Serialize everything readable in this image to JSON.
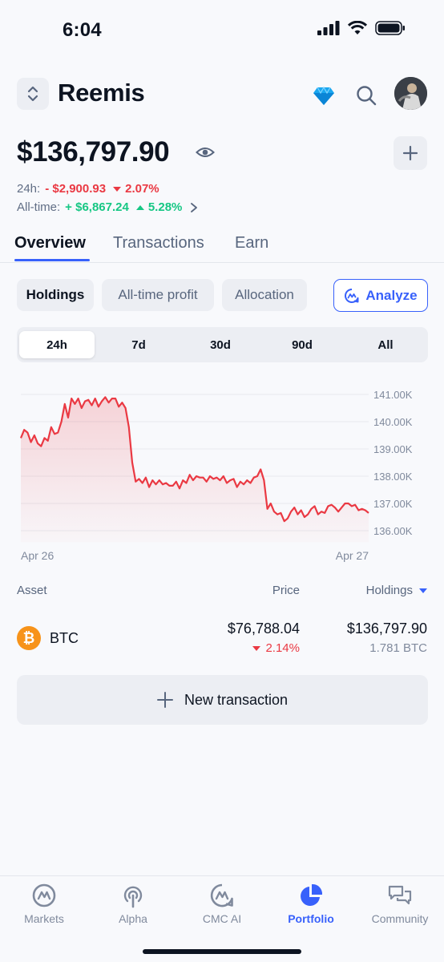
{
  "status_bar": {
    "time": "6:04"
  },
  "header": {
    "portfolio_name": "Reemis"
  },
  "summary": {
    "balance": "$136,797.90",
    "day_label": "24h:",
    "day_change_value": "- $2,900.93",
    "day_change_percent": "2.07%",
    "all_time_label": "All-time:",
    "all_time_value": "+ $6,867.24",
    "all_time_percent": "5.28%"
  },
  "tabs": [
    {
      "label": "Overview",
      "active": true
    },
    {
      "label": "Transactions",
      "active": false
    },
    {
      "label": "Earn",
      "active": false
    }
  ],
  "views": [
    {
      "label": "Holdings",
      "active": true
    },
    {
      "label": "All-time profit",
      "active": false
    },
    {
      "label": "Allocation",
      "active": false
    }
  ],
  "analyze_label": "Analyze",
  "ranges": [
    {
      "label": "24h",
      "active": true
    },
    {
      "label": "7d",
      "active": false
    },
    {
      "label": "30d",
      "active": false
    },
    {
      "label": "90d",
      "active": false
    },
    {
      "label": "All",
      "active": false
    }
  ],
  "chart_data": {
    "type": "area",
    "x_start_label": "Apr 26",
    "x_end_label": "Apr 27",
    "y_ticks": [
      "141.00K",
      "140.00K",
      "139.00K",
      "138.00K",
      "137.00K",
      "136.00K"
    ],
    "y_tick_values": [
      141000,
      140000,
      139000,
      138000,
      137000,
      136000
    ],
    "ylim": [
      135700,
      141300
    ],
    "grid": true,
    "line_color": "#ea3943",
    "values": [
      139400,
      139700,
      139600,
      139250,
      139500,
      139200,
      139100,
      139400,
      139300,
      139800,
      139550,
      139600,
      140000,
      140650,
      140150,
      140850,
      140650,
      140850,
      140500,
      140750,
      140800,
      140600,
      140850,
      140550,
      140750,
      140900,
      140700,
      140850,
      140850,
      140550,
      140700,
      140500,
      139800,
      138500,
      137800,
      137900,
      137750,
      137950,
      137600,
      137850,
      137700,
      137850,
      137700,
      137750,
      137650,
      137650,
      137800,
      137550,
      137850,
      137750,
      138050,
      137850,
      138000,
      137950,
      137950,
      137800,
      138000,
      137900,
      137950,
      137850,
      138000,
      137750,
      137850,
      137900,
      137600,
      137800,
      137700,
      137850,
      137750,
      137950,
      138000,
      138250,
      137850,
      136800,
      137000,
      136700,
      136600,
      136650,
      136350,
      136450,
      136700,
      136850,
      136600,
      136750,
      136500,
      136600,
      136800,
      136900,
      136600,
      136700,
      136650,
      136900,
      136950,
      136850,
      136700,
      136850,
      137000,
      137000,
      136900,
      136950,
      136750,
      136800,
      136750,
      136650
    ]
  },
  "assets": {
    "col_asset": "Asset",
    "col_price": "Price",
    "col_holdings": "Holdings",
    "rows": [
      {
        "symbol": "BTC",
        "icon": "bitcoin-icon",
        "price": "$76,788.04",
        "change": "2.14%",
        "holdings_value": "$136,797.90",
        "holdings_amount": "1.781 BTC"
      }
    ]
  },
  "new_transaction_label": "New transaction",
  "nav": [
    {
      "label": "Markets",
      "icon": "markets-icon",
      "active": false
    },
    {
      "label": "Alpha",
      "icon": "alpha-icon",
      "active": false
    },
    {
      "label": "CMC AI",
      "icon": "cmc-ai-icon",
      "active": false
    },
    {
      "label": "Portfolio",
      "icon": "portfolio-icon",
      "active": true
    },
    {
      "label": "Community",
      "icon": "community-icon",
      "active": false
    }
  ],
  "colors": {
    "accent": "#3861fb",
    "negative": "#ea3943",
    "positive": "#16c784",
    "bitcoin": "#f7931a"
  }
}
